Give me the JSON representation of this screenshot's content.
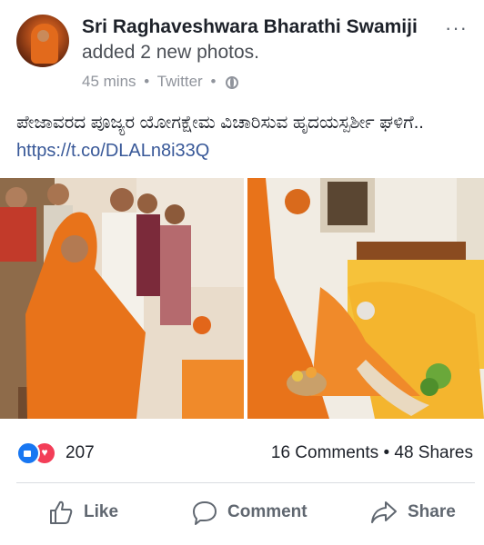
{
  "post": {
    "author": "Sri Raghaveshwara Bharathi Swamiji",
    "action": "added 2 new photos.",
    "time": "45 mins",
    "source": "Twitter",
    "more": "···",
    "caption_text": "ಪೇಜಾವರದ ಪೂಜ್ಯರ ಯೋಗಕ್ಷೇಮ ವಿಚಾರಿಸುವ ಹೃದಯಸ್ಪರ್ಶೀ ಘಳಿಗೆ..",
    "caption_link": "https://t.co/DLALn8i33Q"
  },
  "stats": {
    "reactions_count": "207",
    "comments": "16 Comments",
    "shares": "48 Shares"
  },
  "actions": {
    "like": "Like",
    "comment": "Comment",
    "share": "Share"
  },
  "colors": {
    "link": "#385898",
    "like_blue": "#1877f2",
    "love_red": "#f33e58",
    "saffron": "#e8731a"
  }
}
